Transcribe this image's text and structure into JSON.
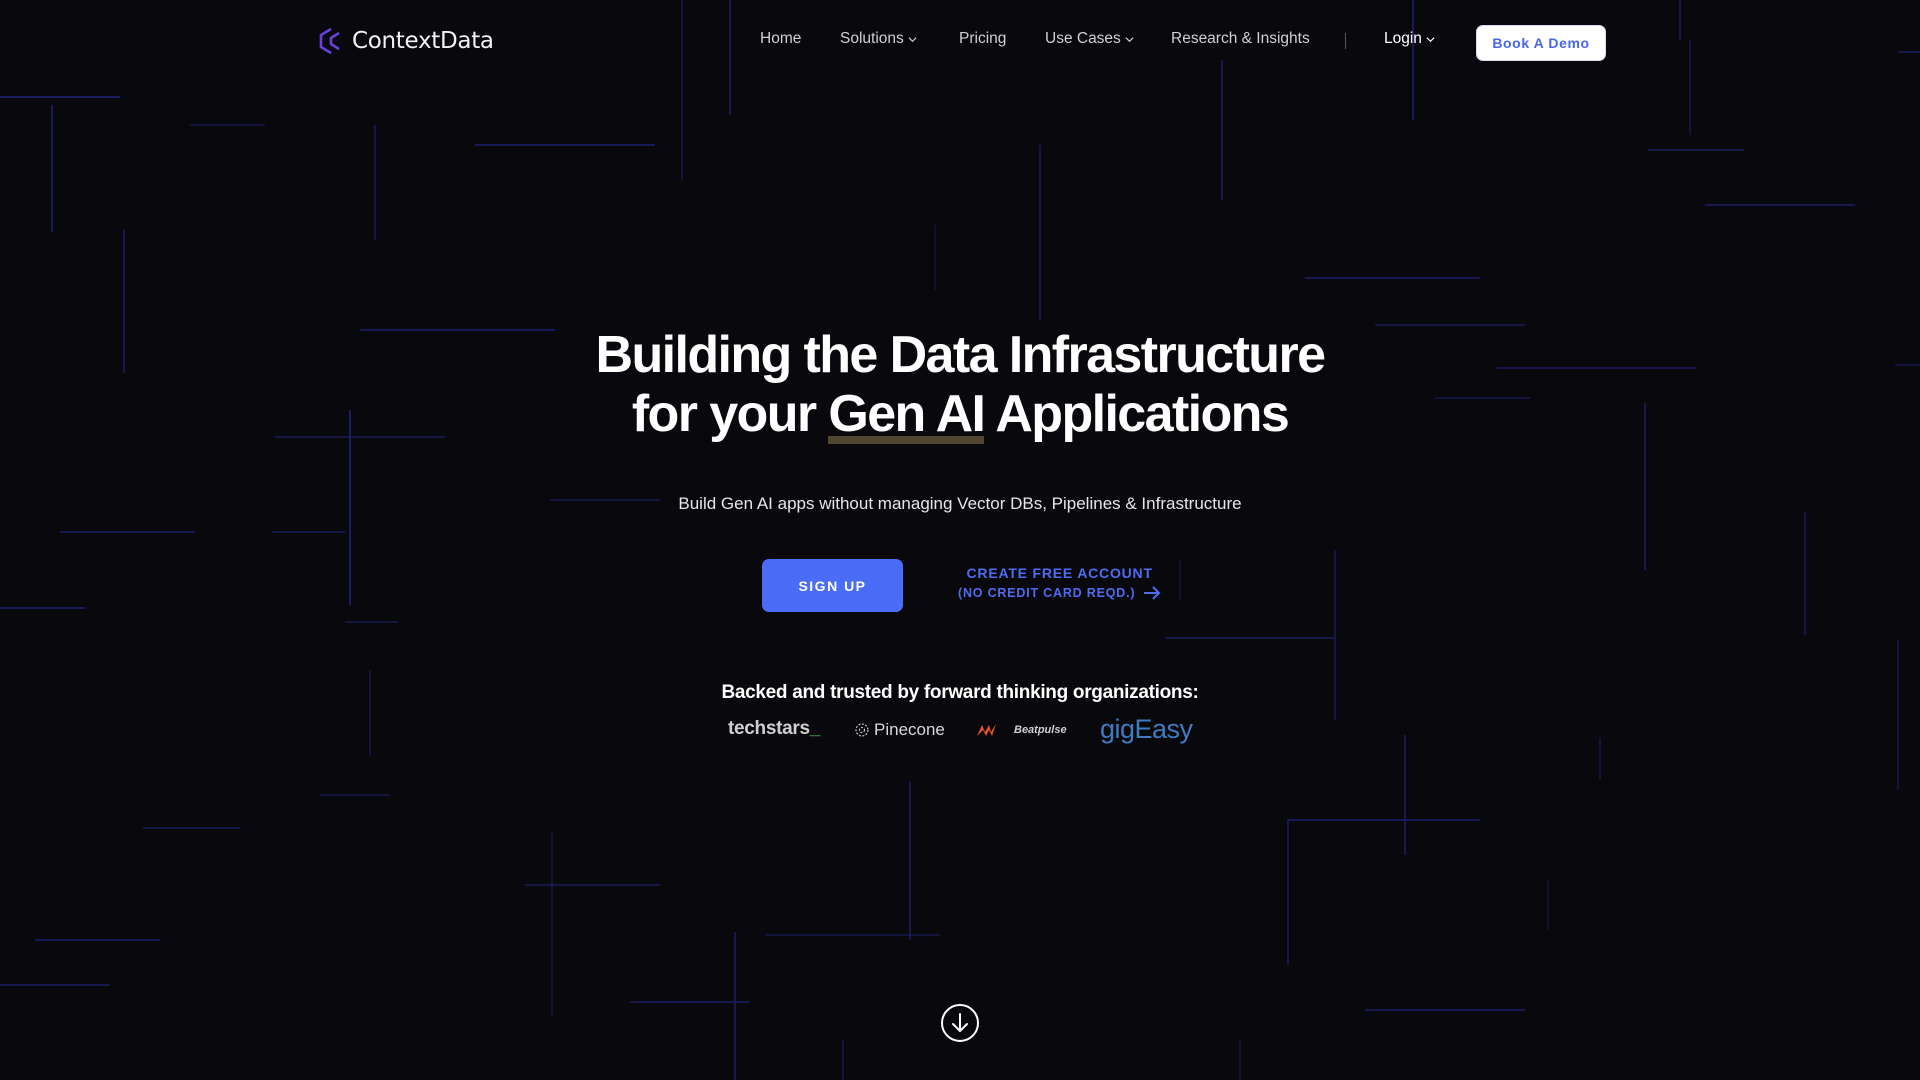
{
  "brand": {
    "name": "ContextData",
    "logo_icon": "contextdata-logo-icon",
    "accent": "#6a3fe0"
  },
  "nav": {
    "items": [
      {
        "label": "Home",
        "has_dropdown": false
      },
      {
        "label": "Solutions",
        "has_dropdown": true
      },
      {
        "label": "Pricing",
        "has_dropdown": false
      },
      {
        "label": "Use Cases",
        "has_dropdown": true
      },
      {
        "label": "Research & Insights",
        "has_dropdown": false
      }
    ],
    "separator": "|",
    "login_label": "Login",
    "demo_label": "Book A Demo"
  },
  "hero": {
    "headline_line1": "Building the Data Infrastructure",
    "headline_line2_pre": "for your ",
    "headline_highlight": "Gen AI",
    "headline_line2_post": " Applications",
    "subtitle": "Build Gen AI apps without managing Vector DBs, Pipelines & Infrastructure",
    "signup_label": "SIGN UP",
    "create_line1": "CREATE FREE ACCOUNT",
    "create_line2": "(NO CREDIT CARD REQD.)",
    "backed_text": "Backed and trusted by forward thinking organizations:"
  },
  "partners": [
    {
      "name": "techstars",
      "suffix": "_"
    },
    {
      "name": "Pinecone"
    },
    {
      "name": "Beatpulse"
    },
    {
      "name": "gigEasy"
    }
  ],
  "scroll_icon": "arrow-down-circle-icon",
  "colors": {
    "background": "#09090d",
    "primary": "#4b6cf7",
    "grid_line": "#1c1f6b",
    "highlight_underline": "#4f4530"
  }
}
